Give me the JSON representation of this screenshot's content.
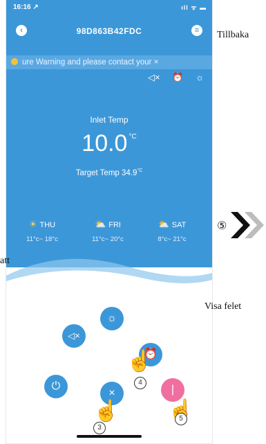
{
  "status_bar": {
    "time": "16:16 ↗",
    "icons": "ıll ᯤ ▬"
  },
  "nav": {
    "back_icon": "‹",
    "title": "98D863B42FDC",
    "menu_icon": "≡"
  },
  "warning": {
    "text": "ure Warning and please contact your ×"
  },
  "controls": {
    "mute": "◁×",
    "alarm": "⏰",
    "sun": "☼"
  },
  "temp": {
    "inlet_label": "Inlet Temp",
    "inlet_value": "10.0",
    "inlet_unit": "°C",
    "target_label": "Target Temp",
    "target_value": "34.9",
    "target_unit": "°C"
  },
  "forecast": [
    {
      "day": "THU",
      "icon": "☀",
      "range": "11°c~ 18°c"
    },
    {
      "day": "FRI",
      "icon": "⛅",
      "range": "11°c~ 20°c"
    },
    {
      "day": "SAT",
      "icon": "⛅",
      "range": "8°c~ 21°c"
    }
  ],
  "buttons": {
    "sun": "☼",
    "mute": "◁×",
    "alarm": "⏰",
    "power": "⏻",
    "close": "×",
    "toggle": "|"
  },
  "markers": {
    "m3": "3",
    "m4": "4",
    "m5a": "5",
    "m5b": "⑤"
  },
  "side": {
    "tillbaka": "Tillbaka",
    "att": "att",
    "visa": "Visa felet"
  },
  "colors": {
    "primary": "#3c97d8",
    "accent": "#f06fa0",
    "warning_dot": "#f3c23b"
  }
}
